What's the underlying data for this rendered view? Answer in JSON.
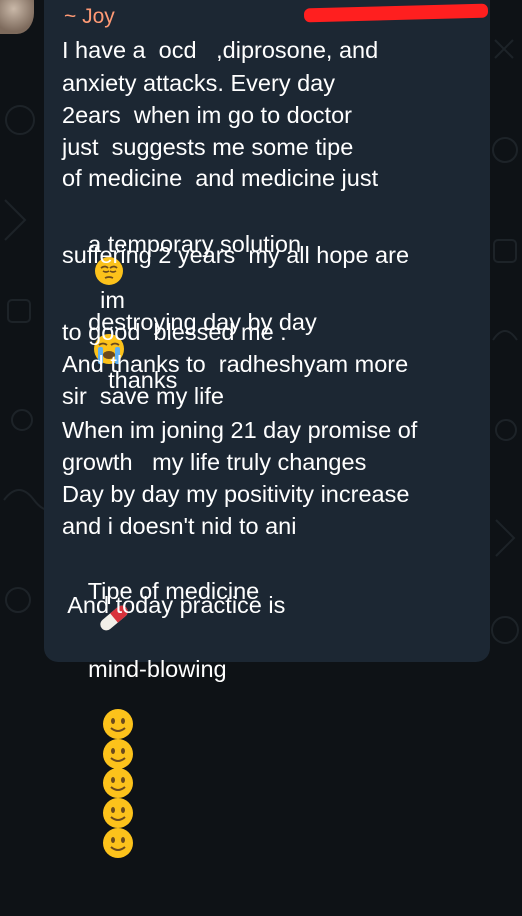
{
  "message": {
    "sender": "~ Joy",
    "lines": [
      "I have a  ocd   ,diprosone, and",
      "anxiety attacks. Every day",
      "2ears  when im go to doctor",
      "just  suggests me some tipe",
      "of medicine  and medicine just",
      "a temporary solution",
      "im",
      "suffering 2 years  my all hope are",
      "destroying day by day",
      "thanks",
      "to good  blessed me .",
      "And thanks to  radheshyam more",
      "sir  save my life",
      "When im joning 21 day promise of",
      "growth   my life truly changes",
      "Day by day my positivity increase",
      "and i doesn't nid to ani",
      "Tipe of medicine",
      " And today practice is",
      "mind-blowing"
    ],
    "emojis": {
      "pensive": "pensive-face-icon",
      "crying": "loudly-crying-face-icon",
      "pill": "pill-icon",
      "smile": "slightly-smiling-face-icon"
    }
  },
  "colors": {
    "background": "#0e1216",
    "bubble": "#1c2733",
    "sender": "#ff9a75",
    "text": "#ffffff",
    "redaction": "#ff1f1f"
  }
}
